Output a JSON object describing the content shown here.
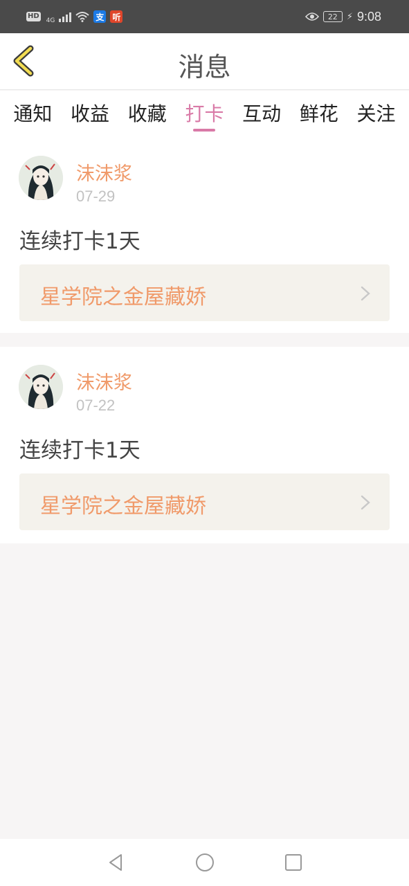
{
  "status_bar": {
    "hd": "HD",
    "network": "4G",
    "alipay_badge": "支",
    "ting_badge": "听",
    "battery": "22",
    "time": "9:08"
  },
  "header": {
    "title": "消息"
  },
  "tabs": [
    {
      "label": "通知",
      "active": false
    },
    {
      "label": "收益",
      "active": false
    },
    {
      "label": "收藏",
      "active": false
    },
    {
      "label": "打卡",
      "active": true
    },
    {
      "label": "互动",
      "active": false
    },
    {
      "label": "鲜花",
      "active": false
    },
    {
      "label": "关注",
      "active": false
    }
  ],
  "messages": [
    {
      "user": "沫沫浆",
      "date": "07-29",
      "text": "连续打卡1天",
      "book": "星学院之金屋藏娇"
    },
    {
      "user": "沫沫浆",
      "date": "07-22",
      "text": "连续打卡1天",
      "book": "星学院之金屋藏娇"
    }
  ],
  "colors": {
    "accent_pink": "#d97aa7",
    "accent_orange": "#f09a6a",
    "status_bar_bg": "#4a4a4a"
  }
}
